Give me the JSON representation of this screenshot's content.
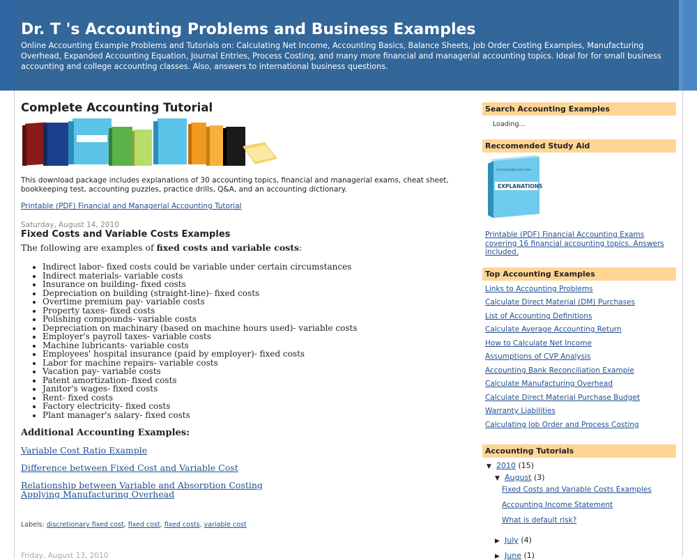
{
  "header": {
    "title": "Dr. T 's Accounting Problems and Business Examples",
    "description": "Online Accounting Example Problems and Tutorials on: Calculating Net Income, Accounting Basics, Balance Sheets, Job Order Costing Examples, Manufacturing Overhead, Expanded Accounting Equation, Journal Entries, Process Costing, and many more financial and managerial accounting topics. Ideal for for small business accounting and college accounting classes. Also, answers to international business questions."
  },
  "tutorial": {
    "title": "Complete Accounting Tutorial",
    "text": "This download package includes explanations of 30 accounting topics, financial and managerial exams, cheat sheet, bookkeeping test, accounting puzzles, practice drills, Q&A, and an accounting dictionary.",
    "link": "Printable (PDF) Financial and Managerial Accounting Tutorial"
  },
  "post": {
    "date": "Saturday, August 14, 2010",
    "title": "Fixed Costs and Variable Costs Examples",
    "lead_prefix": "The following are examples of ",
    "lead_bold": "fixed costs and variable costs",
    "lead_suffix": ":",
    "items": [
      "Indirect labor- fixed costs could be variable under certain circumstances",
      "Indirect materials- variable costs",
      "Insurance on building- fixed costs",
      "Depreciation on building (straight-line)- fixed costs",
      "Overtime premium pay- variable costs",
      "Property taxes- fixed costs",
      "Polishing compounds- variable costs",
      "Depreciation on machinary (based on machine hours used)- variable costs",
      "Employer's payroll taxes- variable costs",
      "Machine lubricants- variable costs",
      "Employees' hospital insurance (paid by employer)- fixed costs",
      "Labor for machine repairs- variable costs",
      "Vacation pay- variable costs",
      "Patent amortization- fixed costs",
      "Janitor's wages- fixed costs",
      "Rent- fixed costs",
      "Factory electricity- fixed costs",
      "Plant manager's salary- fixed costs"
    ],
    "additional_heading": "Additional Accounting Examples:",
    "links": [
      "Variable Cost Ratio Example",
      "Difference between Fixed Cost and Variable Cost",
      "Relationship between Variable and Absorption Costing",
      "Applying Manufacturing Overhead"
    ],
    "labels_prefix": "Labels:",
    "labels": [
      "discretionary fixed cost",
      "fixed cost",
      "fixed costs",
      "variable cost"
    ],
    "next_post_date": "Friday, August 13, 2010"
  },
  "sidebar": {
    "search": {
      "heading": "Search Accounting Examples",
      "status": "Loading..."
    },
    "study_aid": {
      "heading": "Reccomended Study Aid",
      "box_label": "EXPLANATIONS",
      "box_site": "AccountingCoach.com",
      "link": "Printable (PDF) Financial Accounting Exams covering 16 financial accounting topics. Answers included."
    },
    "top": {
      "heading": "Top Accounting Examples",
      "links": [
        "Links to Accounting Problems",
        "Calculate Direct Material (DM) Purchases",
        "List of Accounting Definitions",
        "Calculate Average Accounting Return",
        "How to Calculate Net Income",
        "Assumptions of CVP Analysis",
        "Accounting Bank Reconciliation Example",
        "Calculate Manufacturing Overhead",
        "Calculate Direct Material Purchase Budget",
        "Warranty Liabilities",
        "Calculating Job Order and Process Costing"
      ]
    },
    "tutorials": {
      "heading": "Accounting Tutorials",
      "year": "2010",
      "year_count": "(15)",
      "month": "August",
      "month_count": "(3)",
      "posts": [
        "Fixed Costs and Variable Costs Examples",
        "Accounting Income Statement",
        "What is default risk?"
      ],
      "month2": "July",
      "month2_count": "(4)",
      "month3": "June",
      "month3_count": "(1)"
    }
  },
  "colors": {
    "header_bg": "#336699",
    "sidebar_heading_bg": "#ffd596",
    "link": "#1f4f8f"
  }
}
